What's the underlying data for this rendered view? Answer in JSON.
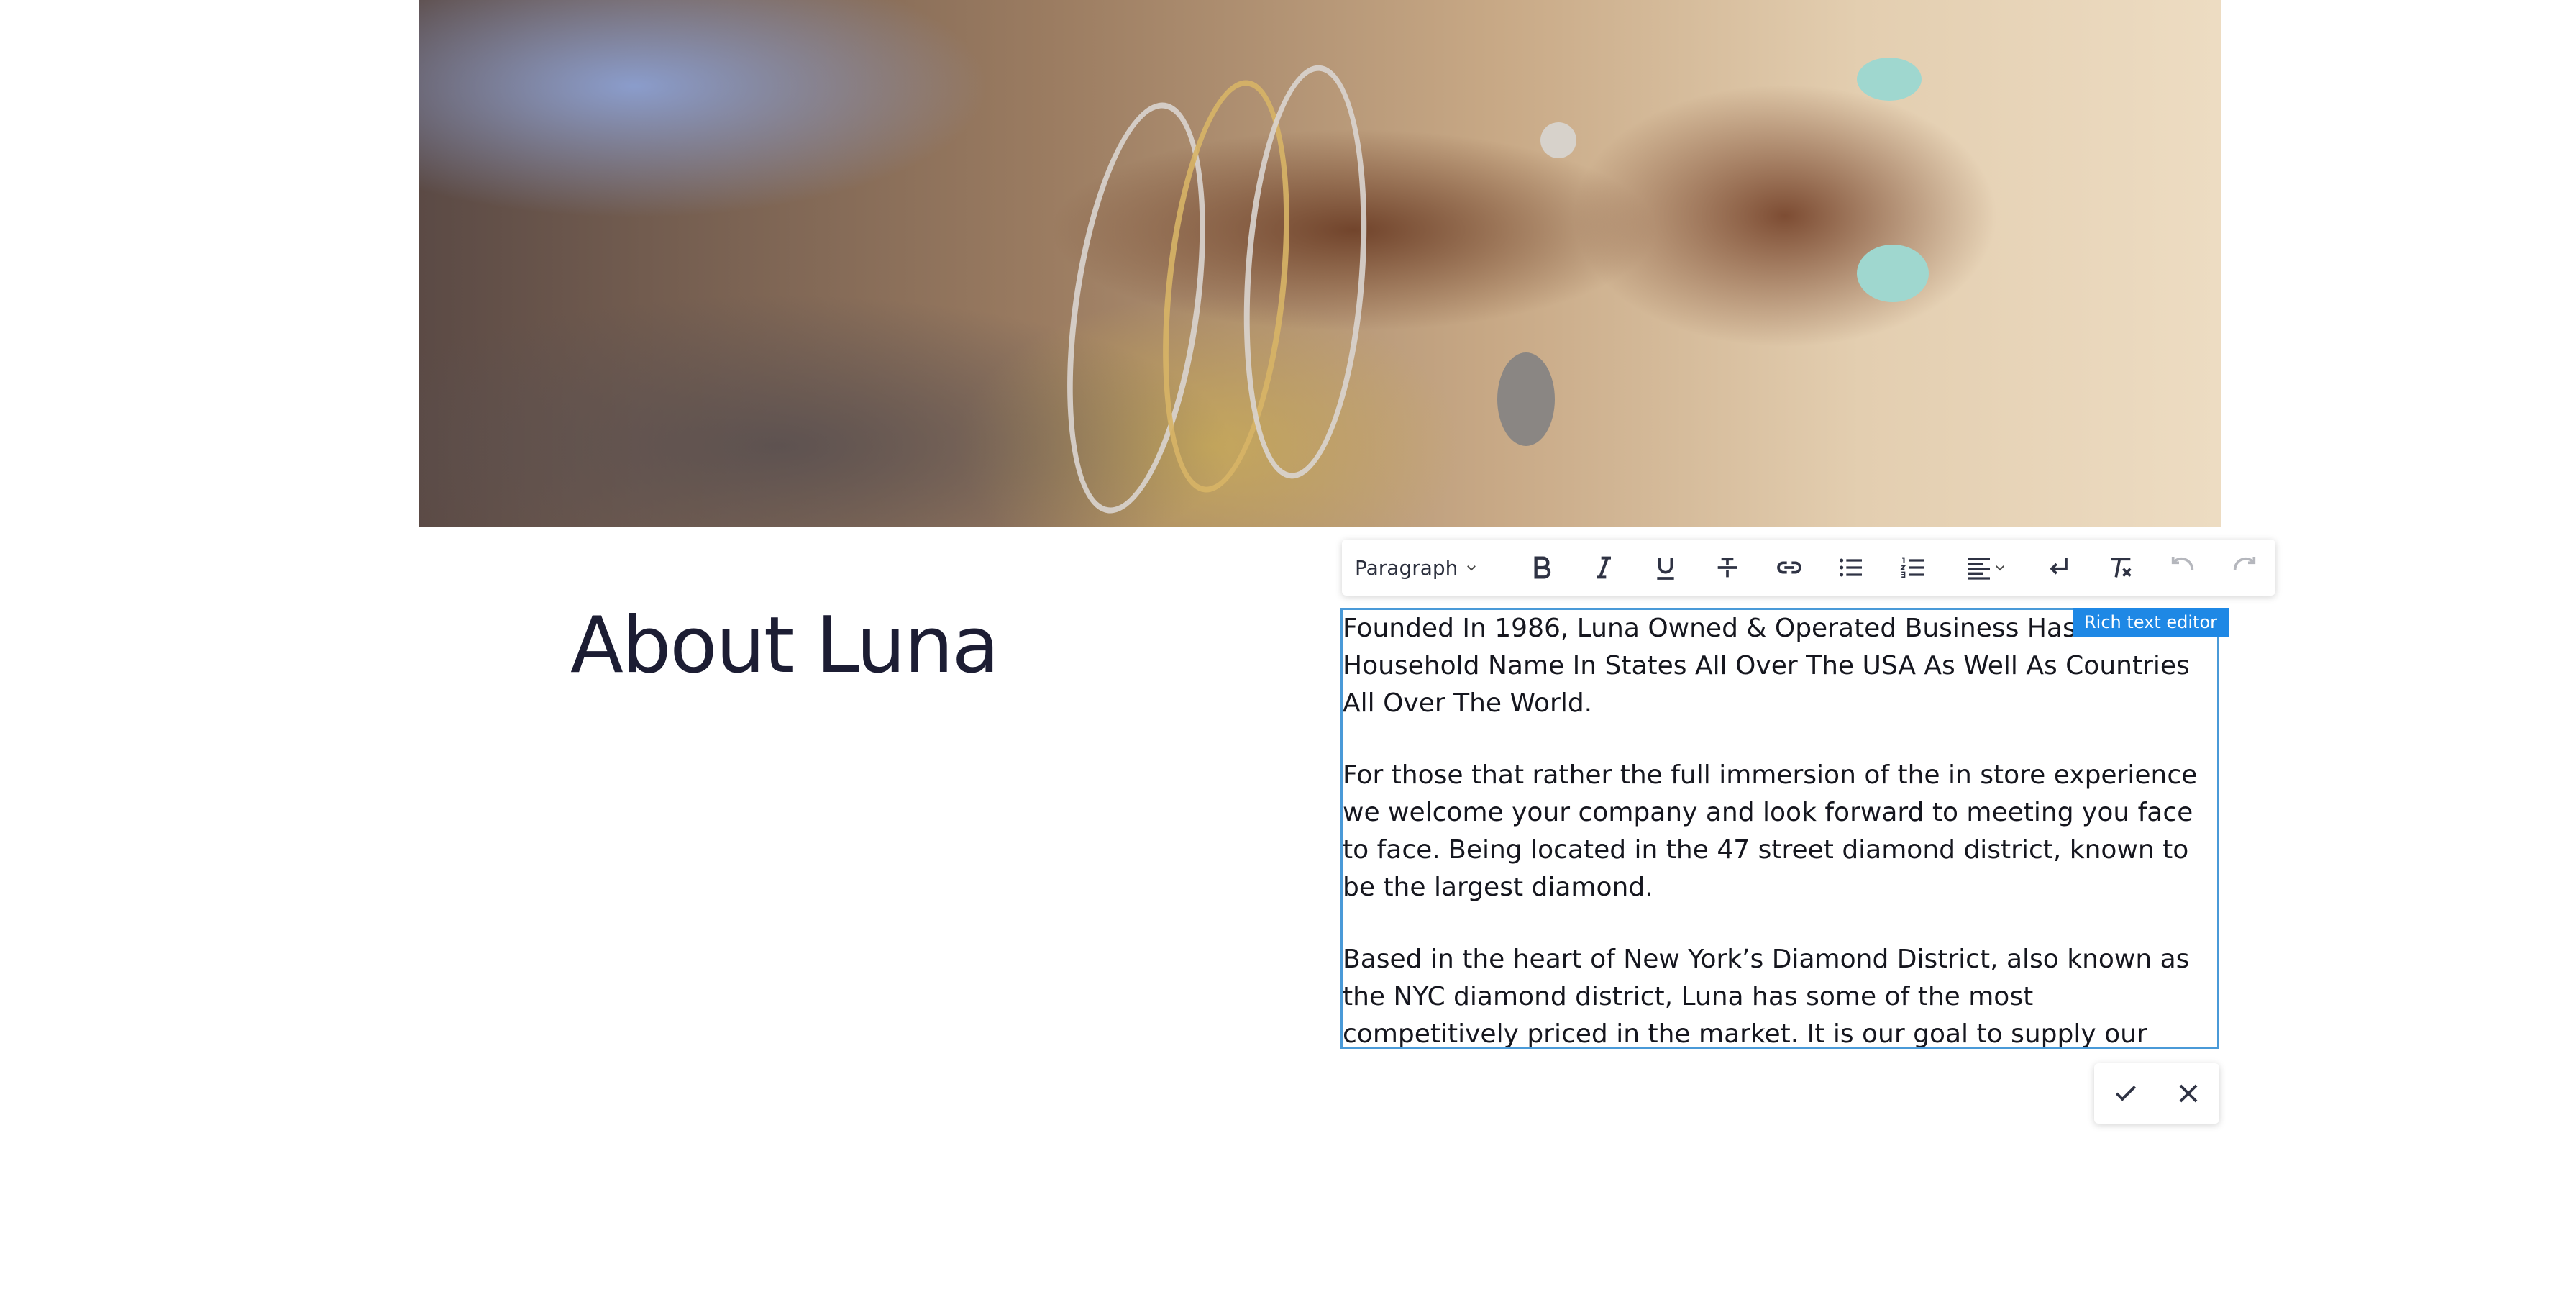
{
  "hero": {
    "image_label": "hero-photo-bracelets"
  },
  "section": {
    "heading": "About Luna"
  },
  "toolbar": {
    "block_format": "Paragraph",
    "buttons": [
      {
        "name": "bold-button",
        "icon": "bold-icon"
      },
      {
        "name": "italic-button",
        "icon": "italic-icon"
      },
      {
        "name": "underline-button",
        "icon": "underline-icon"
      },
      {
        "name": "strikethrough-button",
        "icon": "strikethrough-icon"
      },
      {
        "name": "link-button",
        "icon": "link-icon"
      },
      {
        "name": "bullet-list-button",
        "icon": "bulleted-list-icon"
      },
      {
        "name": "numbered-list-button",
        "icon": "numbered-list-icon"
      },
      {
        "name": "align-button",
        "icon": "align-left-icon"
      },
      {
        "name": "line-break-button",
        "icon": "line-break-icon"
      },
      {
        "name": "clear-format-button",
        "icon": "clear-formatting-icon"
      },
      {
        "name": "undo-button",
        "icon": "undo-icon"
      },
      {
        "name": "redo-button",
        "icon": "redo-icon"
      }
    ]
  },
  "editor": {
    "badge": "Rich text editor",
    "paragraphs": [
      "Founded In 1986, Luna Owned & Operated Business Has Become A Household Name In States All Over The USA As Well As Countries All Over The World.",
      "For those that rather the full immersion of the in store experience we welcome your company and look forward to meeting you face to face. Being located in the 47 street diamond district, known to be the largest diamond.",
      "Based in the heart of New York’s Diamond District, also known as the NYC diamond district, Luna has some of the most competitively priced in the market. It is our goal to supply our clients."
    ]
  },
  "actions": {
    "confirm_icon": "check-icon",
    "cancel_icon": "close-icon"
  },
  "colors": {
    "accent": "#1e88e5",
    "editor_border": "#4a9ad8",
    "heading": "#1c1d33"
  }
}
